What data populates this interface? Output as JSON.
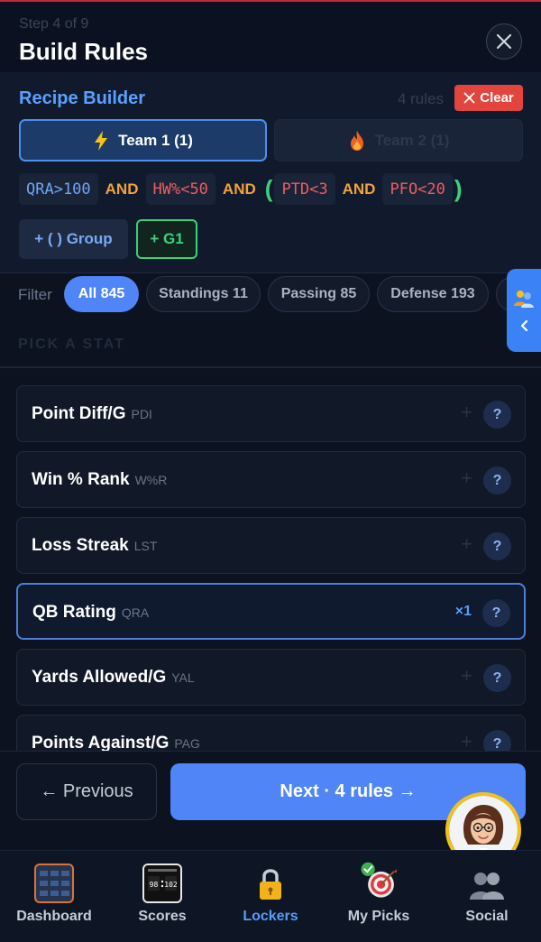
{
  "header": {
    "step": "Step 4 of 9",
    "title": "Build Rules",
    "close_icon": "close-icon"
  },
  "builder": {
    "title": "Recipe Builder",
    "rules_count": "4 rules",
    "clear_label": "Clear",
    "teams": [
      {
        "label": "Team 1 (1)",
        "icon": "lightning-icon"
      },
      {
        "label": "Team 2 (1)",
        "icon": "fire-icon"
      }
    ],
    "expression": {
      "c1": "QRA>100",
      "op1": "AND",
      "c2": "HW%<50",
      "op2": "AND",
      "open": "(",
      "c3": "PTD<3",
      "op3": "AND",
      "c4": "PFO<20",
      "close": ")"
    },
    "group_label": "+ ( ) Group",
    "g1_label": "+ G1"
  },
  "filters": {
    "label": "Filter",
    "pills": [
      "All 845",
      "Standings 11",
      "Passing 85",
      "Defense 193"
    ],
    "active": "All 845",
    "pick_label": "PICK A STAT"
  },
  "stats": [
    {
      "name": "Point Diff/G",
      "abbr": "PDI",
      "action": "+",
      "help": "?"
    },
    {
      "name": "Win % Rank",
      "abbr": "W%R",
      "action": "+",
      "help": "?"
    },
    {
      "name": "Loss Streak",
      "abbr": "LST",
      "action": "+",
      "help": "?"
    },
    {
      "name": "QB Rating",
      "abbr": "QRA",
      "action": "×1",
      "help": "?"
    },
    {
      "name": "Yards Allowed/G",
      "abbr": "YAL",
      "action": "+",
      "help": "?"
    },
    {
      "name": "Points Against/G",
      "abbr": "PAG",
      "action": "+",
      "help": "?"
    }
  ],
  "footer": {
    "prev_label": "← Previous",
    "next_label": "Next · 4 rules →"
  },
  "nav": {
    "items": [
      "Dashboard",
      "Scores",
      "Lockers",
      "My Picks",
      "Social"
    ],
    "active": "Lockers",
    "scoreboard_left": "98",
    "scoreboard_right": "102"
  },
  "colors": {
    "accent": "#4f85f7",
    "and_operator": "#f2a33a",
    "paren": "#3bd17b",
    "clear": "#e2453d"
  }
}
